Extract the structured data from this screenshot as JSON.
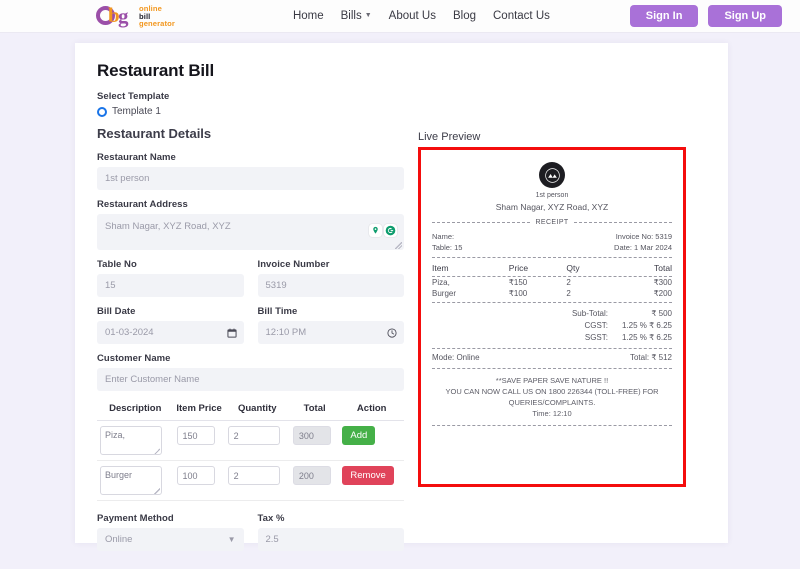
{
  "brand": {
    "logo_online": "online",
    "logo_bill": "bill",
    "logo_generator": "generator",
    "logo_letter_b": "b",
    "logo_letter_g": "g"
  },
  "nav": {
    "links": [
      {
        "label": "Home",
        "has_caret": false
      },
      {
        "label": "Bills",
        "has_caret": true
      },
      {
        "label": "About Us",
        "has_caret": false
      },
      {
        "label": "Blog",
        "has_caret": false
      },
      {
        "label": "Contact Us",
        "has_caret": false
      }
    ],
    "sign_in": "Sign In",
    "sign_up": "Sign Up",
    "accent_color": "#a971d8"
  },
  "form": {
    "page_title": "Restaurant Bill",
    "select_template_label": "Select Template",
    "template_option": "Template 1",
    "details_heading": "Restaurant Details",
    "restaurant_name_label": "Restaurant Name",
    "restaurant_name_placeholder": "1st person",
    "restaurant_address_label": "Restaurant Address",
    "restaurant_address_placeholder": "Sham Nagar, XYZ Road, XYZ",
    "table_no_label": "Table No",
    "table_no_placeholder": "15",
    "invoice_number_label": "Invoice Number",
    "invoice_number_placeholder": "5319",
    "bill_date_label": "Bill Date",
    "bill_date_value": "01-03-2024",
    "bill_time_label": "Bill Time",
    "bill_time_value": "12:10 PM",
    "customer_name_label": "Customer Name",
    "customer_name_placeholder": "Enter Customer Name",
    "payment_method_label": "Payment Method",
    "payment_method_value": "Online",
    "tax_label": "Tax %",
    "tax_value": "2.5"
  },
  "items_table": {
    "headers": [
      "Description",
      "Item Price",
      "Quantity",
      "Total",
      "Action"
    ],
    "rows": [
      {
        "description": "Piza,",
        "price": "150",
        "qty": "2",
        "total": "300",
        "action": "Add",
        "action_type": "add"
      },
      {
        "description": "Burger",
        "price": "100",
        "qty": "2",
        "total": "200",
        "action": "Remove",
        "action_type": "remove"
      }
    ]
  },
  "preview": {
    "label": "Live Preview",
    "border_color": "#f40d0d",
    "shop_name": "1st person",
    "shop_address": "Sham Nagar, XYZ Road, XYZ",
    "receipt_word": "RECEIPT",
    "name_line": "Name:",
    "table_line": "Table: 15",
    "invoice_line": "Invoice No: 5319",
    "date_line": "Date: 1 Mar 2024",
    "columns": [
      "Item",
      "Price",
      "Qty",
      "Total"
    ],
    "items": [
      {
        "item": "Piza,",
        "price": "₹150",
        "qty": "2",
        "total": "₹300"
      },
      {
        "item": "Burger",
        "price": "₹100",
        "qty": "2",
        "total": "₹200"
      }
    ],
    "subtotal_label": "Sub-Total:",
    "subtotal_value": "₹ 500",
    "cgst_label": "CGST:",
    "cgst_value": "1.25 % ₹ 6.25",
    "sgst_label": "SGST:",
    "sgst_value": "1.25 % ₹ 6.25",
    "mode_label": "Mode: Online",
    "total_label": "Total: ₹ 512",
    "footer_line1": "**SAVE PAPER SAVE NATURE !!",
    "footer_line2": "YOU CAN NOW CALL US ON 1800 226344 (TOLL-FREE) FOR QUERIES/COMPLAINTS.",
    "footer_line3": "Time: 12:10"
  }
}
